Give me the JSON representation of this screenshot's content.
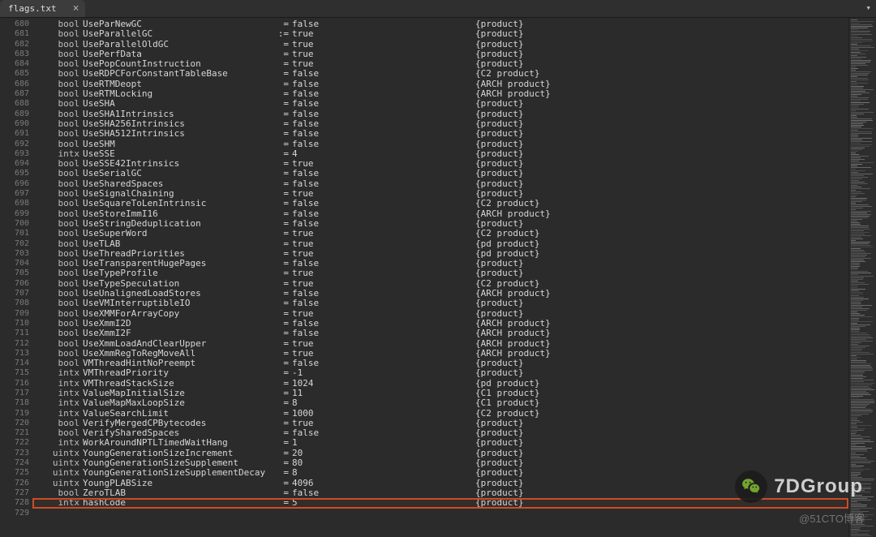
{
  "tab": {
    "title": "flags.txt",
    "close": "×"
  },
  "chevron": "▾",
  "watermark": {
    "brand": "7DGroup",
    "footer": "@51CTO博客"
  },
  "rows": [
    {
      "ln": 680,
      "type": "bool",
      "name": "UseParNewGC",
      "op": "=",
      "val": "false",
      "cat": "{product}"
    },
    {
      "ln": 681,
      "type": "bool",
      "name": "UseParallelGC",
      "op": ":=",
      "val": "true",
      "cat": "{product}"
    },
    {
      "ln": 682,
      "type": "bool",
      "name": "UseParallelOldGC",
      "op": "=",
      "val": "true",
      "cat": "{product}"
    },
    {
      "ln": 683,
      "type": "bool",
      "name": "UsePerfData",
      "op": "=",
      "val": "true",
      "cat": "{product}"
    },
    {
      "ln": 684,
      "type": "bool",
      "name": "UsePopCountInstruction",
      "op": "=",
      "val": "true",
      "cat": "{product}"
    },
    {
      "ln": 685,
      "type": "bool",
      "name": "UseRDPCForConstantTableBase",
      "op": "=",
      "val": "false",
      "cat": "{C2 product}"
    },
    {
      "ln": 686,
      "type": "bool",
      "name": "UseRTMDeopt",
      "op": "=",
      "val": "false",
      "cat": "{ARCH product}"
    },
    {
      "ln": 687,
      "type": "bool",
      "name": "UseRTMLocking",
      "op": "=",
      "val": "false",
      "cat": "{ARCH product}"
    },
    {
      "ln": 688,
      "type": "bool",
      "name": "UseSHA",
      "op": "=",
      "val": "false",
      "cat": "{product}"
    },
    {
      "ln": 689,
      "type": "bool",
      "name": "UseSHA1Intrinsics",
      "op": "=",
      "val": "false",
      "cat": "{product}"
    },
    {
      "ln": 690,
      "type": "bool",
      "name": "UseSHA256Intrinsics",
      "op": "=",
      "val": "false",
      "cat": "{product}"
    },
    {
      "ln": 691,
      "type": "bool",
      "name": "UseSHA512Intrinsics",
      "op": "=",
      "val": "false",
      "cat": "{product}"
    },
    {
      "ln": 692,
      "type": "bool",
      "name": "UseSHM",
      "op": "=",
      "val": "false",
      "cat": "{product}"
    },
    {
      "ln": 693,
      "type": "intx",
      "name": "UseSSE",
      "op": "=",
      "val": "4",
      "cat": "{product}"
    },
    {
      "ln": 694,
      "type": "bool",
      "name": "UseSSE42Intrinsics",
      "op": "=",
      "val": "true",
      "cat": "{product}"
    },
    {
      "ln": 695,
      "type": "bool",
      "name": "UseSerialGC",
      "op": "=",
      "val": "false",
      "cat": "{product}"
    },
    {
      "ln": 696,
      "type": "bool",
      "name": "UseSharedSpaces",
      "op": "=",
      "val": "false",
      "cat": "{product}"
    },
    {
      "ln": 697,
      "type": "bool",
      "name": "UseSignalChaining",
      "op": "=",
      "val": "true",
      "cat": "{product}"
    },
    {
      "ln": 698,
      "type": "bool",
      "name": "UseSquareToLenIntrinsic",
      "op": "=",
      "val": "false",
      "cat": "{C2 product}"
    },
    {
      "ln": 699,
      "type": "bool",
      "name": "UseStoreImmI16",
      "op": "=",
      "val": "false",
      "cat": "{ARCH product}"
    },
    {
      "ln": 700,
      "type": "bool",
      "name": "UseStringDeduplication",
      "op": "=",
      "val": "false",
      "cat": "{product}"
    },
    {
      "ln": 701,
      "type": "bool",
      "name": "UseSuperWord",
      "op": "=",
      "val": "true",
      "cat": "{C2 product}"
    },
    {
      "ln": 702,
      "type": "bool",
      "name": "UseTLAB",
      "op": "=",
      "val": "true",
      "cat": "{pd product}"
    },
    {
      "ln": 703,
      "type": "bool",
      "name": "UseThreadPriorities",
      "op": "=",
      "val": "true",
      "cat": "{pd product}"
    },
    {
      "ln": 704,
      "type": "bool",
      "name": "UseTransparentHugePages",
      "op": "=",
      "val": "false",
      "cat": "{product}"
    },
    {
      "ln": 705,
      "type": "bool",
      "name": "UseTypeProfile",
      "op": "=",
      "val": "true",
      "cat": "{product}"
    },
    {
      "ln": 706,
      "type": "bool",
      "name": "UseTypeSpeculation",
      "op": "=",
      "val": "true",
      "cat": "{C2 product}"
    },
    {
      "ln": 707,
      "type": "bool",
      "name": "UseUnalignedLoadStores",
      "op": "=",
      "val": "false",
      "cat": "{ARCH product}"
    },
    {
      "ln": 708,
      "type": "bool",
      "name": "UseVMInterruptibleIO",
      "op": "=",
      "val": "false",
      "cat": "{product}"
    },
    {
      "ln": 709,
      "type": "bool",
      "name": "UseXMMForArrayCopy",
      "op": "=",
      "val": "true",
      "cat": "{product}"
    },
    {
      "ln": 710,
      "type": "bool",
      "name": "UseXmmI2D",
      "op": "=",
      "val": "false",
      "cat": "{ARCH product}"
    },
    {
      "ln": 711,
      "type": "bool",
      "name": "UseXmmI2F",
      "op": "=",
      "val": "false",
      "cat": "{ARCH product}"
    },
    {
      "ln": 712,
      "type": "bool",
      "name": "UseXmmLoadAndClearUpper",
      "op": "=",
      "val": "true",
      "cat": "{ARCH product}"
    },
    {
      "ln": 713,
      "type": "bool",
      "name": "UseXmmRegToRegMoveAll",
      "op": "=",
      "val": "true",
      "cat": "{ARCH product}"
    },
    {
      "ln": 714,
      "type": "bool",
      "name": "VMThreadHintNoPreempt",
      "op": "=",
      "val": "false",
      "cat": "{product}"
    },
    {
      "ln": 715,
      "type": "intx",
      "name": "VMThreadPriority",
      "op": "=",
      "val": "-1",
      "cat": "{product}"
    },
    {
      "ln": 716,
      "type": "intx",
      "name": "VMThreadStackSize",
      "op": "=",
      "val": "1024",
      "cat": "{pd product}"
    },
    {
      "ln": 717,
      "type": "intx",
      "name": "ValueMapInitialSize",
      "op": "=",
      "val": "11",
      "cat": "{C1 product}"
    },
    {
      "ln": 718,
      "type": "intx",
      "name": "ValueMapMaxLoopSize",
      "op": "=",
      "val": "8",
      "cat": "{C1 product}"
    },
    {
      "ln": 719,
      "type": "intx",
      "name": "ValueSearchLimit",
      "op": "=",
      "val": "1000",
      "cat": "{C2 product}"
    },
    {
      "ln": 720,
      "type": "bool",
      "name": "VerifyMergedCPBytecodes",
      "op": "=",
      "val": "true",
      "cat": "{product}"
    },
    {
      "ln": 721,
      "type": "bool",
      "name": "VerifySharedSpaces",
      "op": "=",
      "val": "false",
      "cat": "{product}"
    },
    {
      "ln": 722,
      "type": "intx",
      "name": "WorkAroundNPTLTimedWaitHang",
      "op": "=",
      "val": "1",
      "cat": "{product}"
    },
    {
      "ln": 723,
      "type": "uintx",
      "name": "YoungGenerationSizeIncrement",
      "op": "=",
      "val": "20",
      "cat": "{product}"
    },
    {
      "ln": 724,
      "type": "uintx",
      "name": "YoungGenerationSizeSupplement",
      "op": "=",
      "val": "80",
      "cat": "{product}"
    },
    {
      "ln": 725,
      "type": "uintx",
      "name": "YoungGenerationSizeSupplementDecay",
      "op": "=",
      "val": "8",
      "cat": "{product}"
    },
    {
      "ln": 726,
      "type": "uintx",
      "name": "YoungPLABSize",
      "op": "=",
      "val": "4096",
      "cat": "{product}"
    },
    {
      "ln": 727,
      "type": "bool",
      "name": "ZeroTLAB",
      "op": "=",
      "val": "false",
      "cat": "{product}"
    },
    {
      "ln": 728,
      "type": "intx",
      "name": "hashCode",
      "op": "=",
      "val": "5",
      "cat": "{product}",
      "hl": true
    },
    {
      "ln": 729,
      "type": "",
      "name": "",
      "op": "",
      "val": "",
      "cat": ""
    }
  ]
}
